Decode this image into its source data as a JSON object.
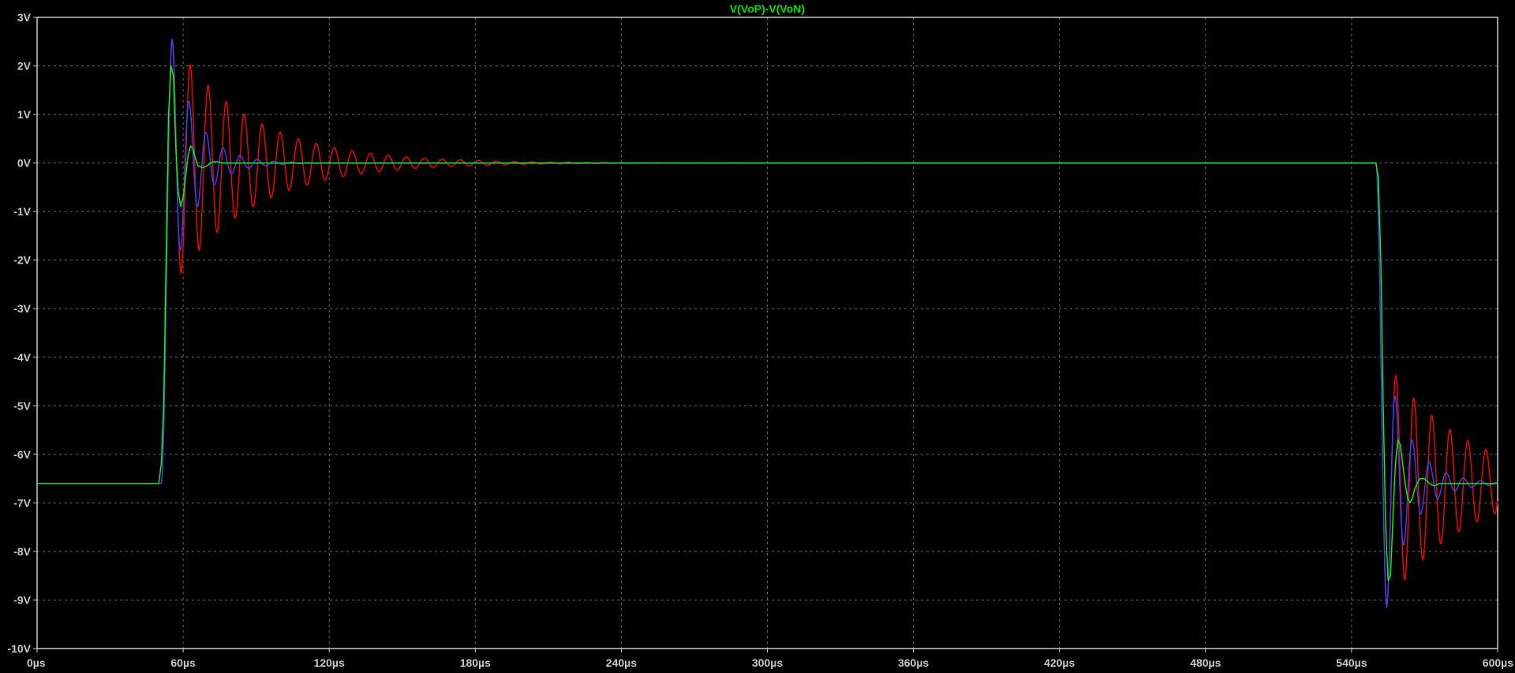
{
  "title": "V(VoP)-V(VoN)",
  "chart_data": {
    "type": "line",
    "title": "V(VoP)-V(VoN)",
    "xlabel": "",
    "ylabel": "",
    "x_unit": "µs",
    "xlim": [
      0,
      600
    ],
    "ylim": [
      -10,
      3
    ],
    "grid": true,
    "x_ticks": [
      0,
      60,
      120,
      180,
      240,
      300,
      360,
      420,
      480,
      540,
      600
    ],
    "y_ticks": [
      3,
      2,
      1,
      0,
      -1,
      -2,
      -3,
      -4,
      -5,
      -6,
      -7,
      -8,
      -9,
      -10
    ],
    "x_tick_labels": [
      "0µs",
      "60µs",
      "120µs",
      "180µs",
      "240µs",
      "300µs",
      "360µs",
      "420µs",
      "480µs",
      "540µs",
      "600µs"
    ],
    "y_tick_labels": [
      "3V",
      "2V",
      "1V",
      "0V",
      "-1V",
      "-2V",
      "-3V",
      "-4V",
      "-5V",
      "-6V",
      "-7V",
      "-8V",
      "-9V",
      "-10V"
    ],
    "series": [
      {
        "color": "#00ff00",
        "x": [
          0,
          50,
          51,
          52,
          53,
          54,
          55,
          56,
          57,
          58,
          59,
          60,
          61,
          62,
          63,
          64,
          65,
          66,
          68,
          70,
          72,
          74,
          76,
          80,
          90,
          100,
          120,
          200,
          300,
          400,
          500,
          550,
          551,
          552,
          553,
          554,
          555,
          556,
          557,
          558,
          559,
          560,
          561,
          562,
          563,
          564,
          565,
          566,
          568,
          570,
          572,
          574,
          576,
          580,
          590,
          600
        ],
        "y": [
          -6.6,
          -6.6,
          -6.2,
          -5.0,
          -2.0,
          1.0,
          2.0,
          1.8,
          0.3,
          -0.6,
          -0.9,
          -0.7,
          -0.3,
          0.15,
          0.35,
          0.3,
          0.1,
          -0.05,
          -0.1,
          -0.05,
          0.02,
          0.03,
          0.0,
          0.0,
          0.0,
          0.0,
          0.0,
          0.0,
          0.0,
          0.0,
          0.0,
          0.0,
          -0.3,
          -2.0,
          -5.0,
          -7.5,
          -8.6,
          -8.5,
          -7.3,
          -6.2,
          -5.7,
          -5.8,
          -6.2,
          -6.6,
          -6.9,
          -7.0,
          -6.9,
          -6.7,
          -6.5,
          -6.5,
          -6.6,
          -6.65,
          -6.6,
          -6.6,
          -6.6,
          -6.6
        ]
      },
      {
        "color": "#4040ff",
        "decay_tau": 10,
        "period": 7,
        "step_up_at": 51,
        "step_down_at": 550,
        "low_level": -6.6,
        "high_level": 0,
        "peak_up": 2.55,
        "peak_down": -9.15
      },
      {
        "color": "#ff0000",
        "decay_tau": 32,
        "period": 7.4,
        "step_up_at": 51,
        "step_down_at": 550,
        "low_level": -6.6,
        "high_level": 0,
        "peak_up": 2.55,
        "peak_down": -9.1
      }
    ]
  }
}
